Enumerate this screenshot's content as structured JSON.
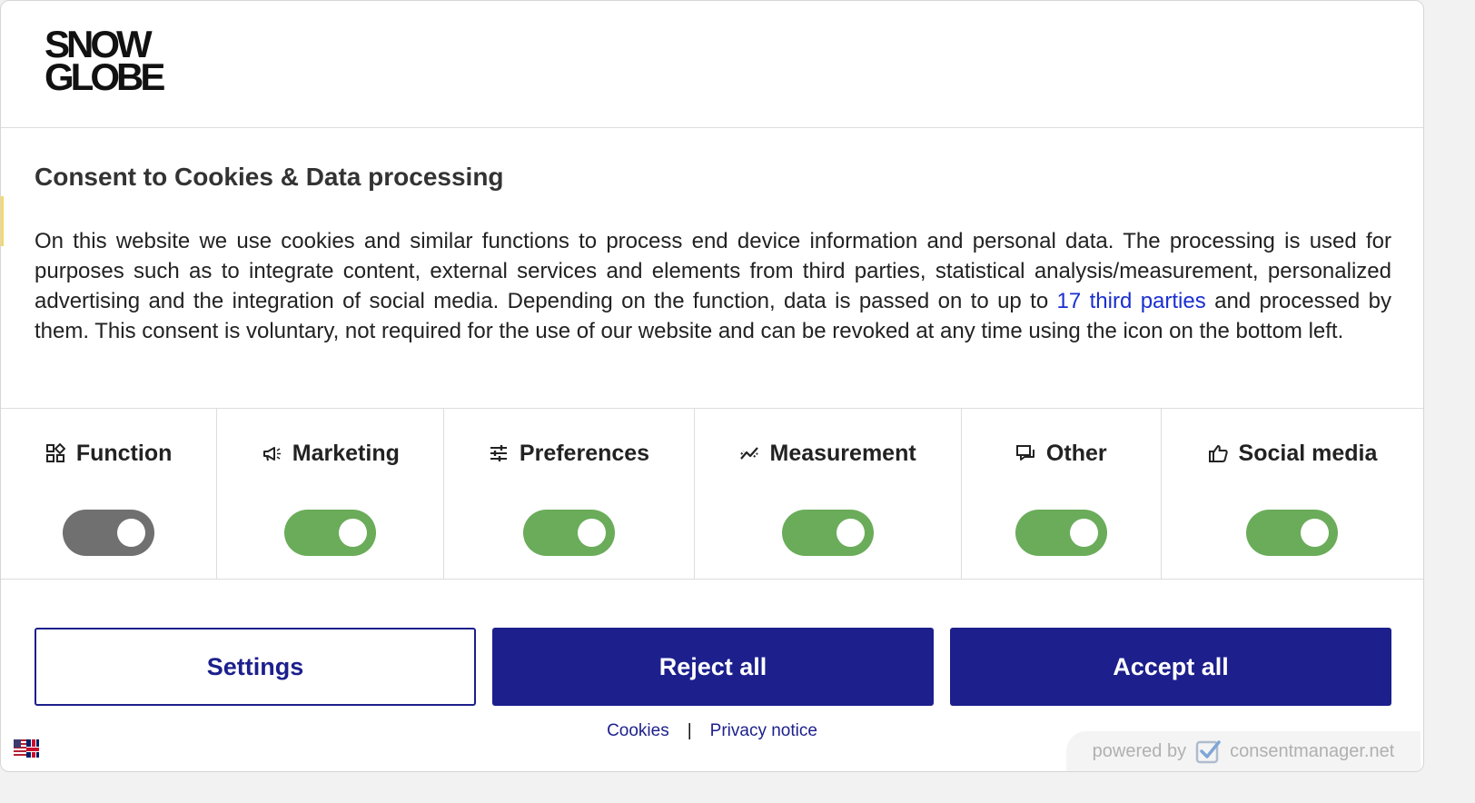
{
  "logo": {
    "line1": "SNOW",
    "line2": "GLOBE"
  },
  "title": "Consent to Cookies & Data processing",
  "body": {
    "text_before_link": "On this website we use cookies and similar functions to process end device information and personal data. The processing is used for purposes such as to integrate content, external services and elements from third parties, statistical analysis/measurement, personalized advertising and the integration of social media. Depending on the function, data is passed on to up to ",
    "link": "17 third parties",
    "text_after_link": " and processed by them. This consent is voluntary, not required for the use of our website and can be revoked at any time using the icon on the bottom left."
  },
  "purposes": [
    {
      "label": "Function",
      "icon": "function-icon",
      "state": "off"
    },
    {
      "label": "Marketing",
      "icon": "megaphone-icon",
      "state": "on"
    },
    {
      "label": "Preferences",
      "icon": "sliders-icon",
      "state": "on"
    },
    {
      "label": "Measurement",
      "icon": "chart-icon",
      "state": "on"
    },
    {
      "label": "Other",
      "icon": "chat-icon",
      "state": "on"
    },
    {
      "label": "Social media",
      "icon": "thumbs-up-icon",
      "state": "on"
    }
  ],
  "buttons": {
    "settings": "Settings",
    "reject": "Reject all",
    "accept": "Accept all"
  },
  "footer": {
    "cookies": "Cookies",
    "separator": "|",
    "privacy": "Privacy notice"
  },
  "powered": {
    "prefix": "powered by",
    "brand": "consentmanager.net"
  },
  "colors": {
    "primary": "#1c1f8c",
    "toggle_on": "#6aac5a",
    "toggle_off": "#707070",
    "link": "#1a2fd0"
  }
}
